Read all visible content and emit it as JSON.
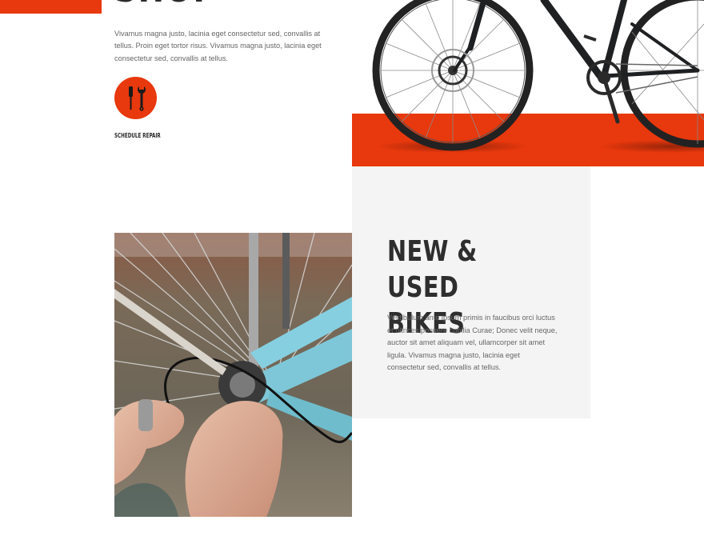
{
  "hero": {
    "intro_text": "Vivamus magna justo, lacinia eget consectetur sed, convallis at tellus. Proin eget tortor risus. Vivamus magna justo, lacinia eget consectetur sed, convallis at tellus.",
    "repair_icon": "wrench-screwdriver-icon",
    "repair_label": "Schedule Repair"
  },
  "bikes_section": {
    "title": "New & Used Bikes",
    "text": "Vestibulum ante ipsum primis in faucibus orci luctus et ultrices posuere cubilia Curae; Donec velit neque, auctor sit amet aliquam vel, ullamcorper sit amet ligula. Vivamus magna justo, lacinia eget consectetur sed, convallis at tellus."
  },
  "colors": {
    "accent": "#e8380d",
    "card_bg": "#f4f4f4",
    "heading": "#2e2e2e",
    "body_text": "#666666",
    "bike_frame": "#1e2022",
    "bike_tire": "#222222",
    "photo_frame_blue": "#7ec7d8"
  }
}
